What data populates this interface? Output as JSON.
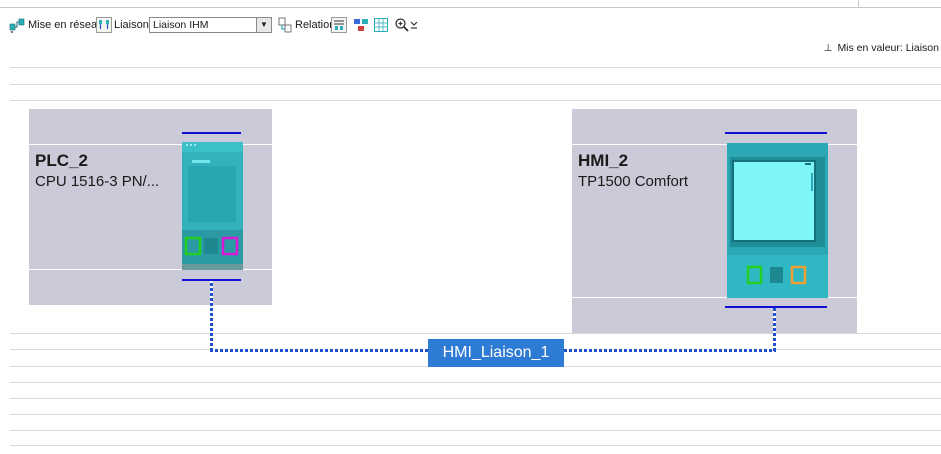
{
  "toolbar": {
    "network_view_label": "Mise en réseau",
    "connections_label": "Liaisons",
    "connection_type_value": "Liaison IHM",
    "relations_label": "Relations"
  },
  "highlight": {
    "label": "Mis en valeur: Liaison"
  },
  "devices": [
    {
      "name": "PLC_2",
      "type": "CPU 1516-3 PN/..."
    },
    {
      "name": "HMI_2",
      "type": "TP1500 Comfort"
    }
  ],
  "connection": {
    "label": "HMI_Liaison_1"
  },
  "colors": {
    "device_box": "#cacad8",
    "device_teal": "#2aaeb8",
    "hmi_screen": "#7ef5f8",
    "rail_blue": "#1010d8",
    "link_label_bg": "#2e7bd6",
    "port_green": "#22d022",
    "port_magenta": "#d81ad8",
    "port_orange": "#f0a030"
  }
}
